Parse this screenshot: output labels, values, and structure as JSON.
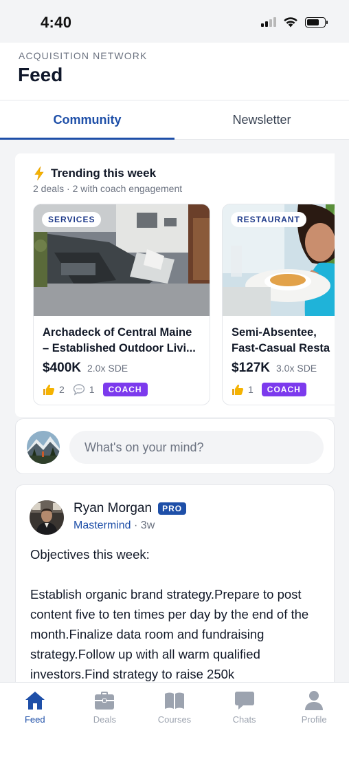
{
  "status_bar": {
    "time": "4:40"
  },
  "header": {
    "eyebrow": "ACQUISITION NETWORK",
    "title": "Feed"
  },
  "tabs": [
    {
      "label": "Community",
      "active": true
    },
    {
      "label": "Newsletter",
      "active": false
    }
  ],
  "trending": {
    "title": "Trending this week",
    "subtitle": "2 deals · 2 with coach engagement",
    "deals": [
      {
        "tag": "SERVICES",
        "name_line1": "Archadeck of Central Maine",
        "name_line2": "– Established Outdoor Livi...",
        "price": "$400K",
        "multiple": "2.0x SDE",
        "likes": "2",
        "comments": "1",
        "badge": "COACH"
      },
      {
        "tag": "RESTAURANT",
        "name_line1": "Semi-Absentee,",
        "name_line2": "Fast-Casual Resta",
        "price": "$127K",
        "multiple": "3.0x SDE",
        "likes": "1",
        "badge": "COACH"
      }
    ]
  },
  "composer": {
    "placeholder": "What's on your mind?"
  },
  "post": {
    "author": "Ryan Morgan",
    "badge": "PRO",
    "group": "Mastermind",
    "separator": " · ",
    "time": "3w",
    "body_line1": "Objectives this week:",
    "body_line2": "Establish organic brand strategy.Prepare to post content five to ten times per day by the end of the month.Finalize data room and fundraising strategy.Follow up with all warm qualified investors.Find strategy to raise 250k"
  },
  "nav": [
    {
      "label": "Feed",
      "icon": "home-icon",
      "active": true
    },
    {
      "label": "Deals",
      "icon": "briefcase-icon",
      "active": false
    },
    {
      "label": "Courses",
      "icon": "book-icon",
      "active": false
    },
    {
      "label": "Chats",
      "icon": "chat-icon",
      "active": false
    },
    {
      "label": "Profile",
      "icon": "user-icon",
      "active": false
    }
  ],
  "colors": {
    "accent": "#1e4fa8",
    "coach": "#7c3aed"
  }
}
